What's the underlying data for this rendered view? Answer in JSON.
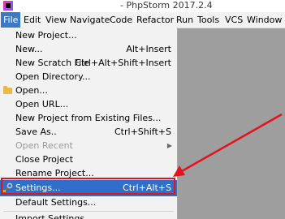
{
  "window": {
    "title": "- PhpStorm 2017.2.4"
  },
  "menubar": {
    "items": [
      "File",
      "Edit",
      "View",
      "Navigate",
      "Code",
      "Refactor",
      "Run",
      "Tools",
      "VCS",
      "Window"
    ]
  },
  "file_menu": {
    "items": [
      {
        "label": "New Project...",
        "shortcut": ""
      },
      {
        "label": "New...",
        "shortcut": "Alt+Insert"
      },
      {
        "label": "New Scratch File",
        "shortcut": "Ctrl+Alt+Shift+Insert"
      },
      {
        "label": "Open Directory...",
        "shortcut": ""
      },
      {
        "label": "Open...",
        "shortcut": "",
        "icon": "folder-icon"
      },
      {
        "label": "Open URL...",
        "shortcut": ""
      },
      {
        "label": "New Project from Existing Files...",
        "shortcut": ""
      },
      {
        "label": "Save As..",
        "shortcut": "Ctrl+Shift+S"
      },
      {
        "label": "Open Recent",
        "shortcut": "",
        "disabled": true,
        "submenu": true
      },
      {
        "label": "Close Project",
        "shortcut": ""
      },
      {
        "label": "Rename Project...",
        "shortcut": ""
      },
      {
        "label": "Settings...",
        "shortcut": "Ctrl+Alt+S",
        "selected": true,
        "icon": "wrench-icon"
      },
      {
        "label": "Default Settings...",
        "shortcut": ""
      },
      {
        "label": "Import Settings...",
        "shortcut": ""
      }
    ]
  },
  "annotation": {
    "color": "#e0141e"
  },
  "colors": {
    "menu_bg": "#f2f2f2",
    "selection": "#2f6fc9",
    "backdrop": "#9e9e9e"
  }
}
